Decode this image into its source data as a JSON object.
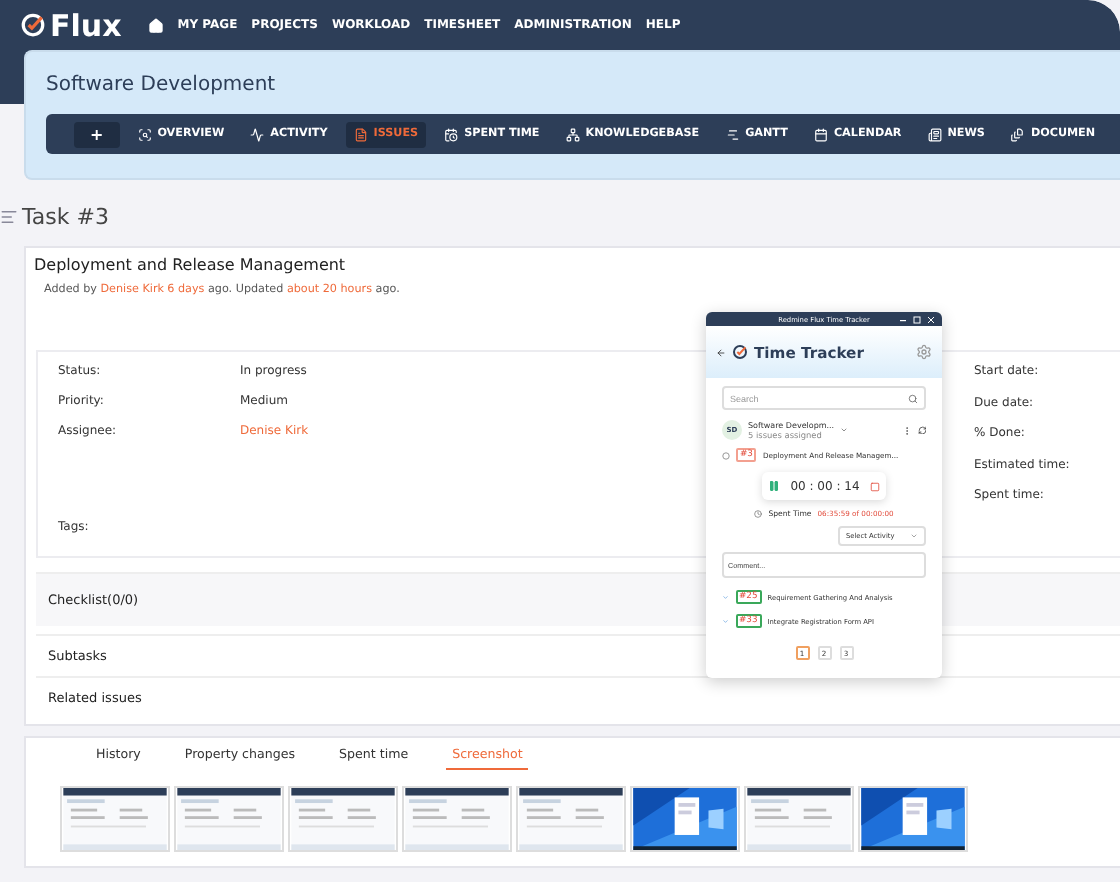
{
  "brand": "Flux",
  "top_nav": [
    "MY PAGE",
    "PROJECTS",
    "WORKLOAD",
    "TIMESHEET",
    "ADMINISTRATION",
    "HELP"
  ],
  "project": {
    "title": "Software Development"
  },
  "toolbar": [
    {
      "label": "+",
      "kind": "add",
      "selected": false
    },
    {
      "label": "OVERVIEW",
      "kind": "overview",
      "selected": false
    },
    {
      "label": "ACTIVITY",
      "kind": "activity",
      "selected": false
    },
    {
      "label": "ISSUES",
      "kind": "issues",
      "selected": true
    },
    {
      "label": "SPENT TIME",
      "kind": "time",
      "selected": false
    },
    {
      "label": "KNOWLEDGEBASE",
      "kind": "kb",
      "selected": false
    },
    {
      "label": "GANTT",
      "kind": "gantt",
      "selected": false
    },
    {
      "label": "CALENDAR",
      "kind": "calendar",
      "selected": false
    },
    {
      "label": "NEWS",
      "kind": "news",
      "selected": false
    },
    {
      "label": "DOCUMEN",
      "kind": "documents",
      "selected": false
    }
  ],
  "issue": {
    "heading": "Task #3",
    "subject": "Deployment and Release Management",
    "byline": [
      {
        "text": "Added by ",
        "link": false
      },
      {
        "text": "Denise Kirk",
        "link": true
      },
      {
        "text": "6 days",
        "link": true
      },
      {
        "text": " ago. Updated ",
        "link": false
      },
      {
        "text": "about 20 hours",
        "link": true
      },
      {
        "text": " ago.",
        "link": false
      }
    ],
    "attributes_left": [
      {
        "label": "Status:",
        "value": "In progress",
        "link": false
      },
      {
        "label": "Priority:",
        "value": "Medium",
        "link": false
      },
      {
        "label": "Assignee:",
        "value": "Denise Kirk",
        "link": true
      }
    ],
    "tags_label": "Tags:",
    "attributes_right": [
      "Start date:",
      "Due date:",
      "% Done:",
      "Estimated time:",
      "Spent time:"
    ]
  },
  "sections": [
    {
      "title": "Checklist(0/0)",
      "shaded": true
    },
    {
      "title": "Subtasks",
      "shaded": false
    },
    {
      "title": "Related issues",
      "shaded": false
    }
  ],
  "tabs": [
    {
      "label": "History",
      "selected": false
    },
    {
      "label": "Property changes",
      "selected": false
    },
    {
      "label": "Spent time",
      "selected": false
    },
    {
      "label": "Screenshot",
      "selected": true
    }
  ],
  "thumbnails": [
    {
      "kind": "app"
    },
    {
      "kind": "app"
    },
    {
      "kind": "app"
    },
    {
      "kind": "app"
    },
    {
      "kind": "app"
    },
    {
      "kind": "desktop"
    },
    {
      "kind": "app"
    },
    {
      "kind": "desktop"
    }
  ],
  "tracker": {
    "window_title": "Redmine Flux Time Tracker",
    "title": "Time Tracker",
    "search": {
      "placeholder": "Search"
    },
    "project": {
      "initials": "SD",
      "name": "Software Developm...",
      "subtitle": "5 issues assigned"
    },
    "current_issue": {
      "id": "#3",
      "title": "Deployment And Release Managem..."
    },
    "timer": "00 : 00 : 14",
    "spent_label": "Spent Time",
    "spent_value": "06:35:59 of 00:00:00",
    "activity": {
      "placeholder": "Select Activity"
    },
    "comment": {
      "placeholder": "Comment..."
    },
    "issues": [
      {
        "id": "#25",
        "title": "Requirement Gathering And Analysis"
      },
      {
        "id": "#33",
        "title": "Integrate Registration Form API"
      }
    ],
    "pages": [
      {
        "label": "1",
        "selected": true
      },
      {
        "label": "2",
        "selected": false
      },
      {
        "label": "3",
        "selected": false
      }
    ]
  }
}
